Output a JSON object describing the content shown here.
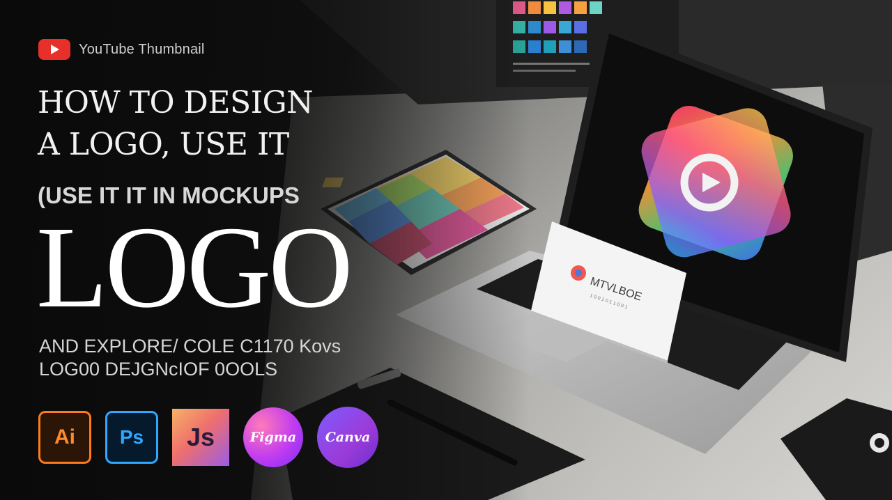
{
  "badge": {
    "label": "YouTube Thumbnail",
    "icon": "youtube-play-icon"
  },
  "headline": {
    "line1": "HOW TO DESIGN",
    "line2": "A LOGO, USE IT",
    "line3": "(USE IT IT IN MOCKUPS",
    "big": "LOGO"
  },
  "subline": {
    "line1": "AND EXPLORE/ COLE C1170 Kovs",
    "line2": "LOG00 DEJGNᴄIOF 0OOLS"
  },
  "tools": [
    {
      "label": "Ai",
      "icon": "adobe-illustrator-icon"
    },
    {
      "label": "Ps",
      "icon": "adobe-photoshop-icon"
    },
    {
      "label": "Js",
      "icon": "js-icon"
    },
    {
      "label": "Figma",
      "icon": "figma-icon"
    },
    {
      "label": "Canva",
      "icon": "canva-icon"
    }
  ],
  "card": {
    "brand": "MTVLBOE",
    "tagline": "1 0 0 1 0 1 1 0 0 1"
  },
  "colors": {
    "youtube_red": "#e8302b",
    "illustrator": "#ff7a1a",
    "photoshop": "#31a8ff",
    "background": "#141414"
  }
}
